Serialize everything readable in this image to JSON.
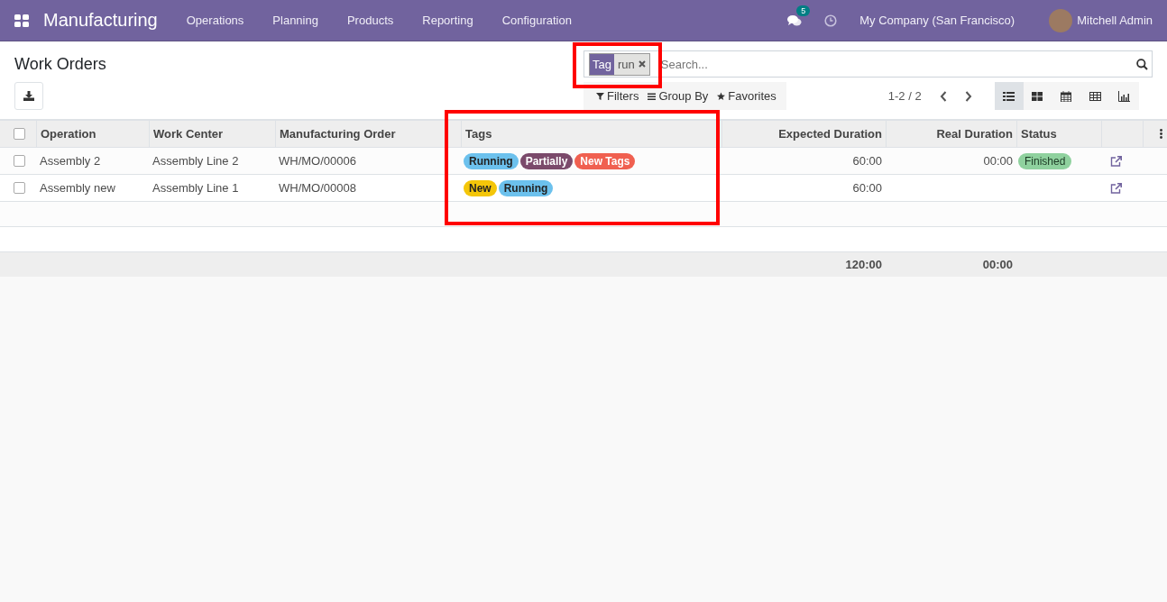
{
  "navbar": {
    "app_name": "Manufacturing",
    "menus": [
      "Operations",
      "Planning",
      "Products",
      "Reporting",
      "Configuration"
    ],
    "messages_badge": "5",
    "company": "My Company (San Francisco)",
    "user": "Mitchell Admin"
  },
  "control_panel": {
    "title": "Work Orders",
    "search": {
      "placeholder": "Search...",
      "facets": [
        {
          "label": "Tag",
          "value": "run",
          "highlighted": true
        }
      ]
    },
    "filter_buttons": [
      "Filters",
      "Group By",
      "Favorites"
    ],
    "pager": "1-2 / 2",
    "views": [
      {
        "kind": "list",
        "selected": true
      },
      {
        "kind": "kanban",
        "selected": false
      },
      {
        "kind": "calendar",
        "selected": false
      },
      {
        "kind": "pivot",
        "selected": false
      },
      {
        "kind": "graph",
        "selected": false
      }
    ]
  },
  "table": {
    "all_selected": false,
    "columns": [
      {
        "label": "Operation"
      },
      {
        "label": "Work Center"
      },
      {
        "label": "Manufacturing Order"
      },
      {
        "label": "Tags",
        "highlighted": true
      },
      {
        "label": "Expected Duration"
      },
      {
        "label": "Real Duration"
      },
      {
        "label": "Status"
      }
    ],
    "rows": [
      {
        "selected": false,
        "operation": "Assembly 2",
        "work_center": "Assembly Line 2",
        "manufacturing_order": "WH/MO/00006",
        "tags": [
          {
            "label": "Running",
            "color": "#6cc1ed"
          },
          {
            "label": "Partially",
            "color": "#7b4a6b"
          },
          {
            "label": "New Tags",
            "color": "#f06050"
          }
        ],
        "expected_duration": "60:00",
        "real_duration": "00:00",
        "status": "Finished"
      },
      {
        "selected": false,
        "operation": "Assembly new",
        "work_center": "Assembly Line 1",
        "manufacturing_order": "WH/MO/00008",
        "tags": [
          {
            "label": "New",
            "color": "#f4c609"
          },
          {
            "label": "Running",
            "color": "#6cc1ed"
          }
        ],
        "expected_duration": "60:00"
      }
    ],
    "totals": {
      "expected_duration": "120:00",
      "real_duration": "00:00"
    }
  }
}
